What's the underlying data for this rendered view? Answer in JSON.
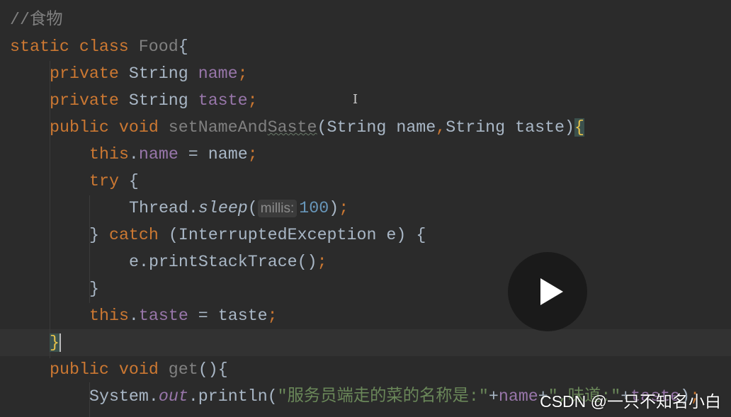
{
  "editor": {
    "lines": [
      {
        "indent": 0,
        "tokens": [
          [
            "//食物",
            "cm"
          ]
        ]
      },
      {
        "indent": 0,
        "tokens": [
          [
            "static ",
            "kw"
          ],
          [
            "class ",
            "kw"
          ],
          [
            "Food",
            "un"
          ],
          [
            "{",
            "ty"
          ]
        ]
      },
      {
        "indent": 1,
        "tokens": [
          [
            "private ",
            "kw"
          ],
          [
            "String ",
            "ty"
          ],
          [
            "name",
            "fd"
          ],
          [
            ";",
            "kw"
          ]
        ]
      },
      {
        "indent": 1,
        "tokens": [
          [
            "private ",
            "kw"
          ],
          [
            "String ",
            "ty"
          ],
          [
            "taste",
            "fd"
          ],
          [
            ";",
            "kw"
          ]
        ]
      },
      {
        "indent": 1,
        "tokens": [
          [
            "public ",
            "kw"
          ],
          [
            "void ",
            "kw"
          ],
          [
            "setNameAnd",
            "un"
          ],
          [
            "Saste",
            "un wavy"
          ],
          [
            "(String name",
            "ty"
          ],
          [
            ",",
            "kw"
          ],
          [
            "String taste)",
            "ty"
          ],
          [
            "{",
            "br"
          ]
        ]
      },
      {
        "indent": 2,
        "tokens": [
          [
            "this",
            "kw"
          ],
          [
            ".",
            "ty"
          ],
          [
            "name",
            "fd"
          ],
          [
            " = name",
            "ty"
          ],
          [
            ";",
            "kw"
          ]
        ]
      },
      {
        "indent": 2,
        "tokens": [
          [
            "try ",
            "kw"
          ],
          [
            "{",
            "ty"
          ]
        ]
      },
      {
        "indent": 3,
        "tokens": [
          [
            "Thread.",
            "ty"
          ],
          [
            "sleep",
            "ty it"
          ],
          [
            "(",
            "ty"
          ],
          [
            "millis:",
            "hint"
          ],
          [
            "100",
            "nm"
          ],
          [
            ")",
            "ty"
          ],
          [
            ";",
            "kw"
          ]
        ]
      },
      {
        "indent": 2,
        "tokens": [
          [
            "} ",
            "ty"
          ],
          [
            "catch ",
            "kw"
          ],
          [
            "(InterruptedException e) {",
            "ty"
          ]
        ]
      },
      {
        "indent": 3,
        "tokens": [
          [
            "e.printStackTrace()",
            "ty"
          ],
          [
            ";",
            "kw"
          ]
        ]
      },
      {
        "indent": 2,
        "tokens": [
          [
            "}",
            "ty"
          ]
        ]
      },
      {
        "indent": 2,
        "tokens": [
          [
            "this",
            "kw"
          ],
          [
            ".",
            "ty"
          ],
          [
            "taste",
            "fd"
          ],
          [
            " = taste",
            "ty"
          ],
          [
            ";",
            "kw"
          ]
        ]
      },
      {
        "indent": 1,
        "tokens": [
          [
            "}",
            "br"
          ]
        ],
        "caret": true
      },
      {
        "indent": 1,
        "tokens": [
          [
            "public ",
            "kw"
          ],
          [
            "void ",
            "kw"
          ],
          [
            "get",
            "un"
          ],
          [
            "(){",
            "ty"
          ]
        ]
      },
      {
        "indent": 2,
        "tokens": [
          [
            "System.",
            "ty"
          ],
          [
            "out",
            "fd it"
          ],
          [
            ".println(",
            "ty"
          ],
          [
            "\"服务员端走的菜的名称是:\"",
            "st"
          ],
          [
            "+",
            "ty"
          ],
          [
            "name",
            "fd"
          ],
          [
            "+",
            "ty"
          ],
          [
            "\",味道:\"",
            "st"
          ],
          [
            "+",
            "ty"
          ],
          [
            "taste",
            "fd"
          ],
          [
            ")",
            "ty"
          ],
          [
            ";",
            "kw"
          ]
        ]
      }
    ]
  },
  "watermark": "CSDN @一只不知名小白",
  "video": {
    "state": "paused"
  }
}
